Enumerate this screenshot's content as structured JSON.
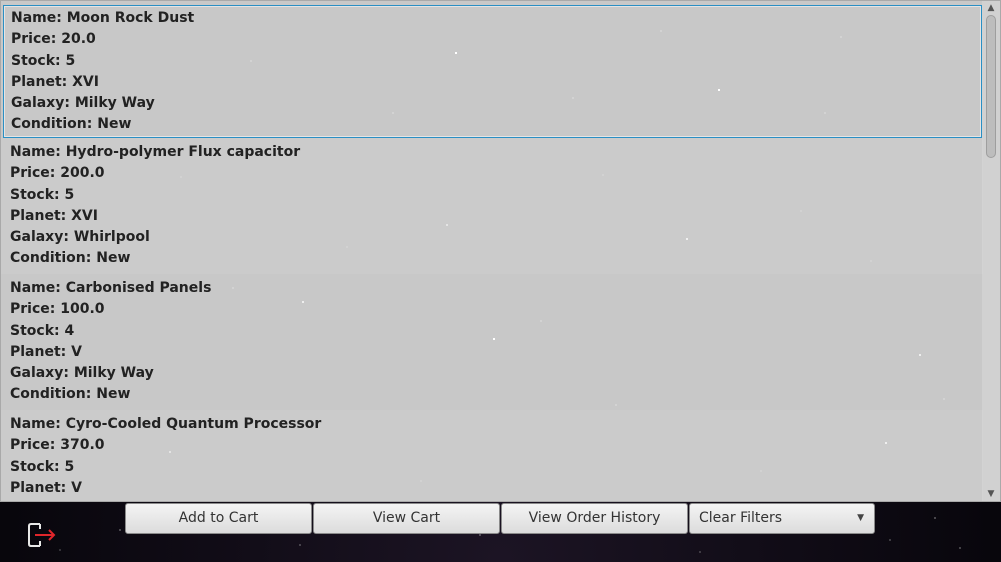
{
  "products": [
    {
      "name": "Name: Moon Rock Dust",
      "price": "Price: 20.0",
      "stock": "Stock: 5",
      "planet": "Planet: XVI",
      "galaxy": "Galaxy: Milky Way",
      "condition": "Condition: New"
    },
    {
      "name": "Name: Hydro-polymer Flux capacitor",
      "price": "Price: 200.0",
      "stock": "Stock: 5",
      "planet": "Planet: XVI",
      "galaxy": "Galaxy: Whirlpool",
      "condition": "Condition: New"
    },
    {
      "name": "Name: Carbonised Panels",
      "price": "Price: 100.0",
      "stock": "Stock: 4",
      "planet": "Planet: V",
      "galaxy": "Galaxy: Milky Way",
      "condition": "Condition: New"
    },
    {
      "name": "Name: Cyro-Cooled Quantum Processor",
      "price": "Price: 370.0",
      "stock": "Stock: 5",
      "planet": "Planet: V",
      "galaxy": "",
      "condition": ""
    }
  ],
  "toolbar": {
    "add_to_cart": "Add to Cart",
    "view_cart": "View Cart",
    "view_order_history": "View Order History",
    "filter_selected": "Clear Filters"
  },
  "icons": {
    "logout": "logout-icon",
    "scroll_up": "chevron-up-icon",
    "scroll_down": "chevron-down-icon",
    "dropdown": "chevron-down-icon"
  },
  "colors": {
    "selection_border": "#2a8fc4",
    "logout_arrow": "#e0262b"
  }
}
